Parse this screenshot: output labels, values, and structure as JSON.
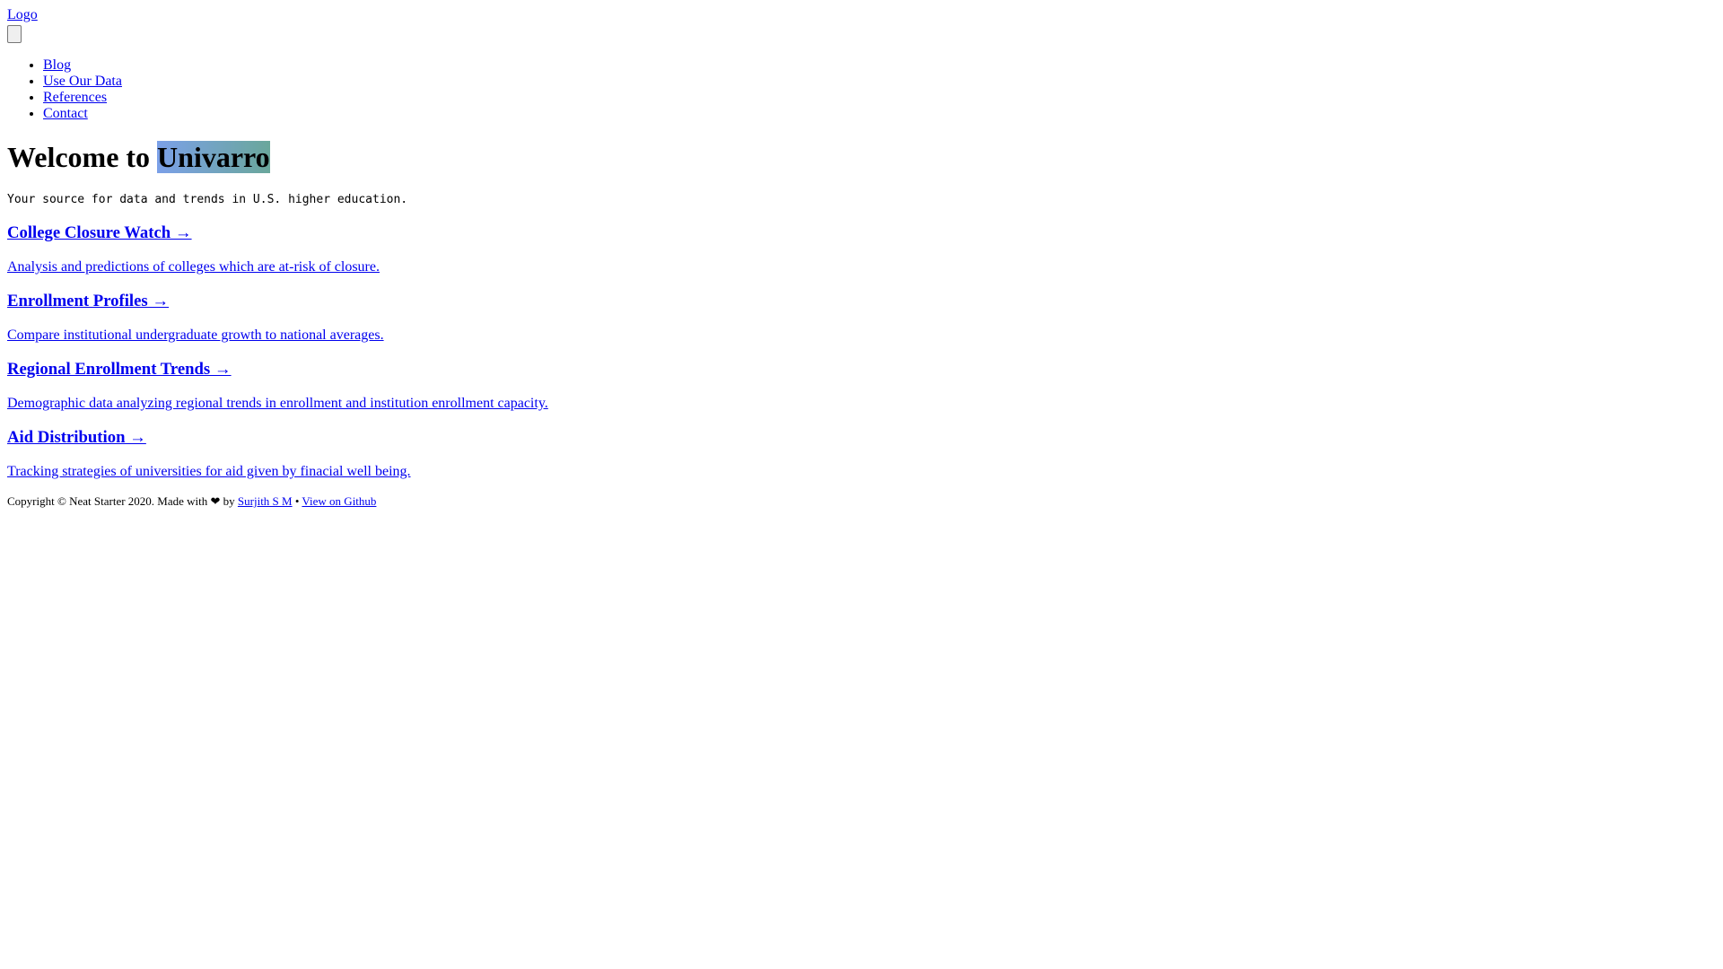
{
  "header": {
    "logo_label": "Logo",
    "menu_toggle_label": ""
  },
  "nav": {
    "items": [
      {
        "label": "Blog"
      },
      {
        "label": "Use Our Data"
      },
      {
        "label": "References"
      },
      {
        "label": "Contact"
      }
    ]
  },
  "hero": {
    "title_prefix": "Welcome to ",
    "brand": "Univarro",
    "tagline": "Your source for data and trends in U.S. higher education."
  },
  "features": [
    {
      "title": "College Closure Watch →",
      "description": "Analysis and predictions of colleges which are at-risk of closure."
    },
    {
      "title": "Enrollment Profiles →",
      "description": "Compare institutional undergraduate growth to national averages."
    },
    {
      "title": "Regional Enrollment Trends →",
      "description": "Demographic data analyzing regional trends in enrollment and institution enrollment capacity."
    },
    {
      "title": "Aid Distribution →",
      "description": "Tracking strategies of universities for aid given by finacial well being."
    }
  ],
  "footer": {
    "copyright": "Copyright © Neat Starter 2020. Made with ❤ by ",
    "author_link": "Surjith S M",
    "separator": " • ",
    "github_link": "View on Github"
  },
  "colors": {
    "link": "#0000ee",
    "brand_gradient_start": "#7ba0e8",
    "brand_gradient_end": "#6aa79b"
  }
}
